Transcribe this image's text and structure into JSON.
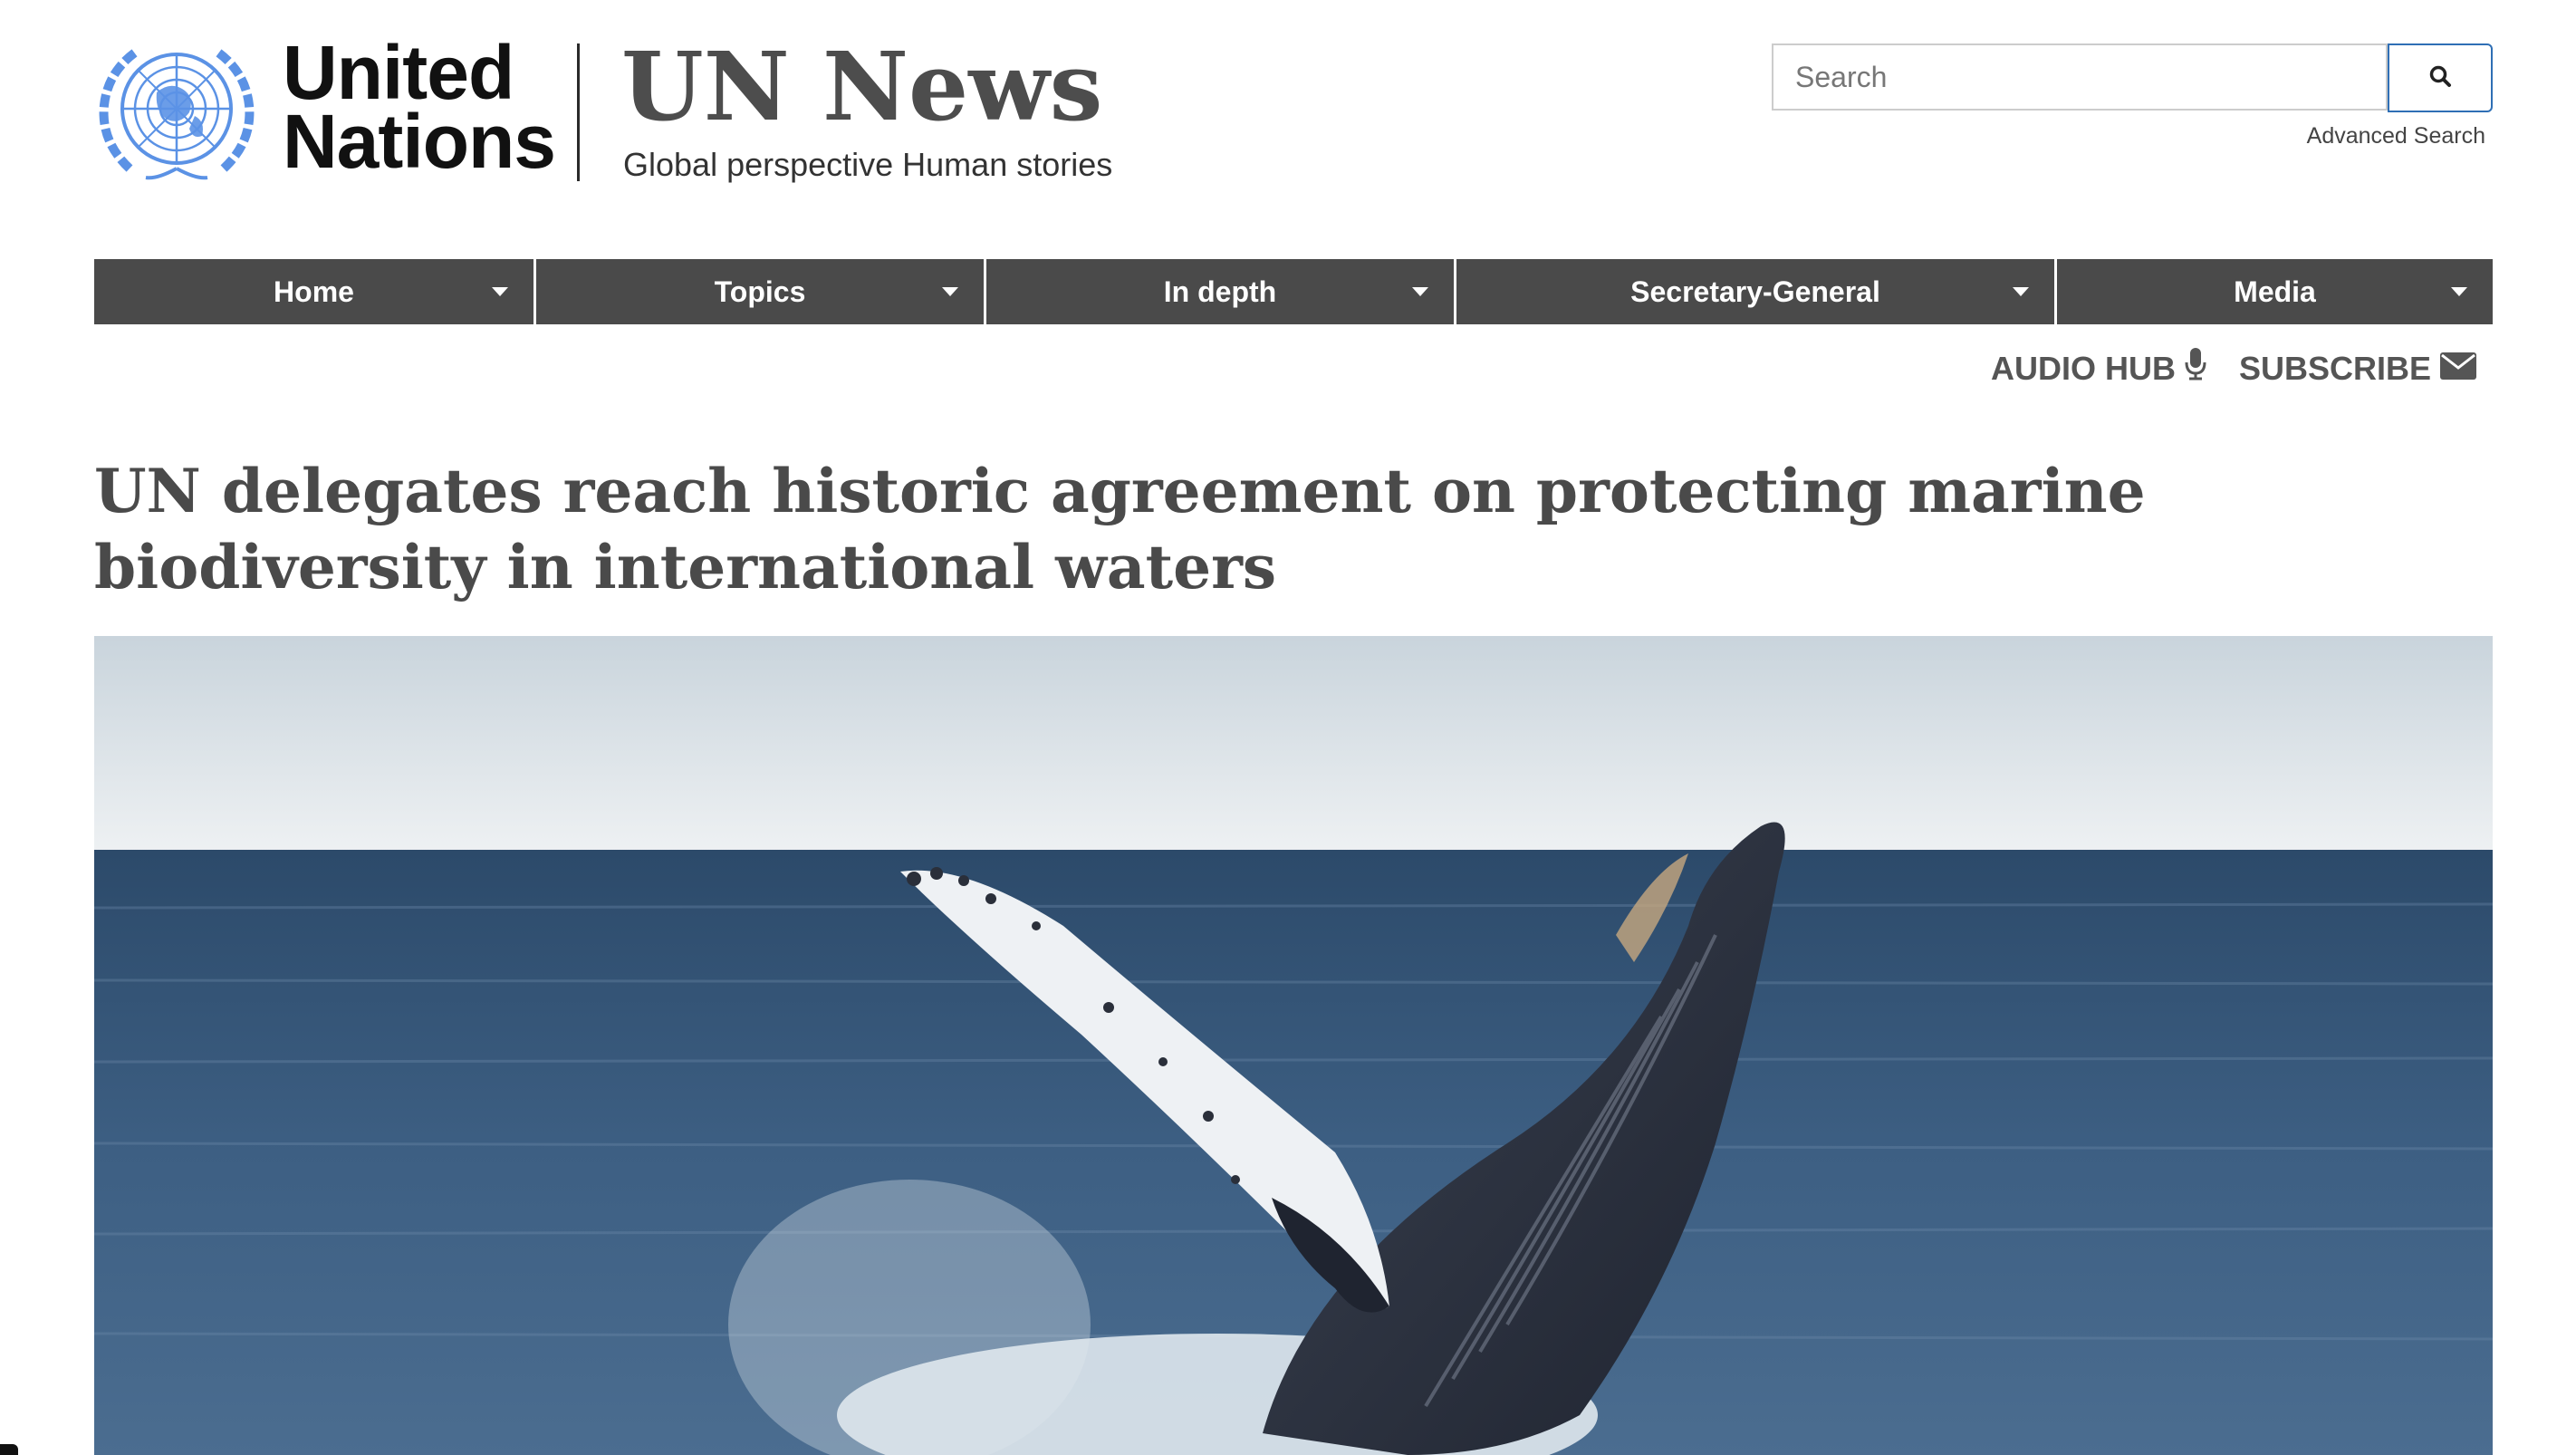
{
  "header": {
    "org_name_line1": "United",
    "org_name_line2": "Nations",
    "site_title": "UN News",
    "tagline": "Global perspective Human stories",
    "emblem_icon": "un-emblem-icon",
    "brand_color": "#5b92e5"
  },
  "search": {
    "placeholder": "Search",
    "value": "",
    "button_icon": "search-icon",
    "advanced_label": "Advanced Search",
    "accent_color": "#2f6fb5"
  },
  "nav": {
    "items": [
      {
        "label": "Home"
      },
      {
        "label": "Topics"
      },
      {
        "label": "In depth"
      },
      {
        "label": "Secretary-General"
      },
      {
        "label": "Media"
      }
    ],
    "caret_icon": "chevron-down-icon",
    "background": "#4a4a4a"
  },
  "utility": {
    "audio_hub_label": "AUDIO HUB",
    "audio_hub_icon": "microphone-icon",
    "subscribe_label": "SUBSCRIBE",
    "subscribe_icon": "envelope-icon"
  },
  "article": {
    "title": "UN delegates reach historic agreement on protecting marine biodiversity in international waters",
    "hero_image_subject": "humpback-whale-breaching-photo"
  }
}
